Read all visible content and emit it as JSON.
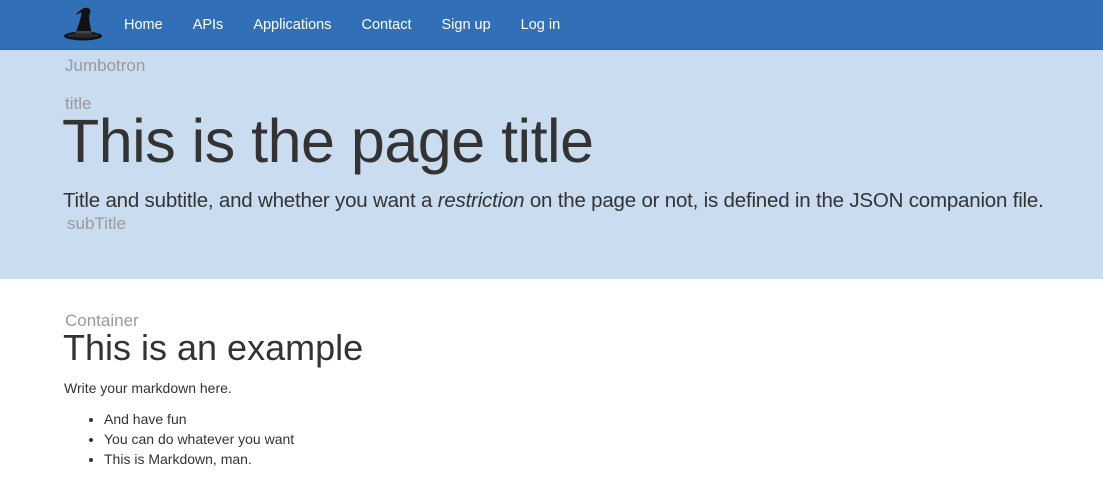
{
  "navbar": {
    "logo_icon": "wizard-hat-icon",
    "links": [
      "Home",
      "APIs",
      "Applications",
      "Contact",
      "Sign up",
      "Log in"
    ],
    "background": "#3170b7"
  },
  "jumbotron": {
    "annotation": "Jumbotron",
    "title_annotation": "title",
    "title": "This is the page title",
    "subtitle_pre": "Title and subtitle, and whether you want a ",
    "subtitle_em": "restriction",
    "subtitle_post": " on the page or not, is defined in the JSON companion file.",
    "subtitle_annotation": "subTitle",
    "background": "#c9dcf0"
  },
  "container": {
    "annotation": "Container",
    "heading": "This is an example",
    "intro": "Write your markdown here.",
    "items": [
      "And have fun",
      "You can do whatever you want",
      "This is Markdown, man."
    ]
  }
}
